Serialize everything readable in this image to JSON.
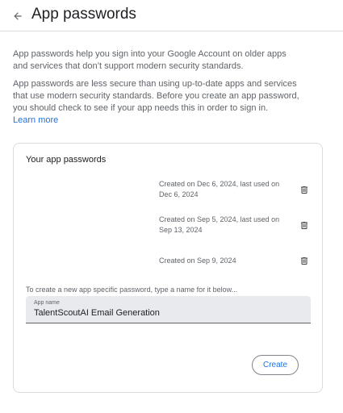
{
  "header": {
    "title": "App passwords",
    "back_icon": "arrow-back-icon"
  },
  "intro": {
    "paragraph1": "App passwords help you sign into your Google Account on older apps and services that don’t support modern security standards.",
    "paragraph2": "App passwords are less secure than using up-to-date apps and services that use modern security standards. Before you create an app password, you should check to see if your app needs this in order to sign in.",
    "learn_more": "Learn more"
  },
  "card": {
    "title": "Your app passwords",
    "passwords": [
      {
        "info": "Created on Dec 6, 2024, last used on Dec 6, 2024",
        "delete_icon": "trash-icon"
      },
      {
        "info": "Created on Sep 5, 2024, last used on Sep 13, 2024",
        "delete_icon": "trash-icon"
      },
      {
        "info": "Created on Sep 9, 2024",
        "delete_icon": "trash-icon"
      }
    ],
    "create_hint": "To create a new app specific password, type a name for it below...",
    "field_label": "App name",
    "field_value": "TalentScoutAI Email Generation",
    "create_button": "Create"
  },
  "colors": {
    "accent": "#1a73e8",
    "text": "#202124",
    "secondary_text": "#5f6368",
    "border": "#dadce0",
    "field_bg": "#e8eaed"
  }
}
